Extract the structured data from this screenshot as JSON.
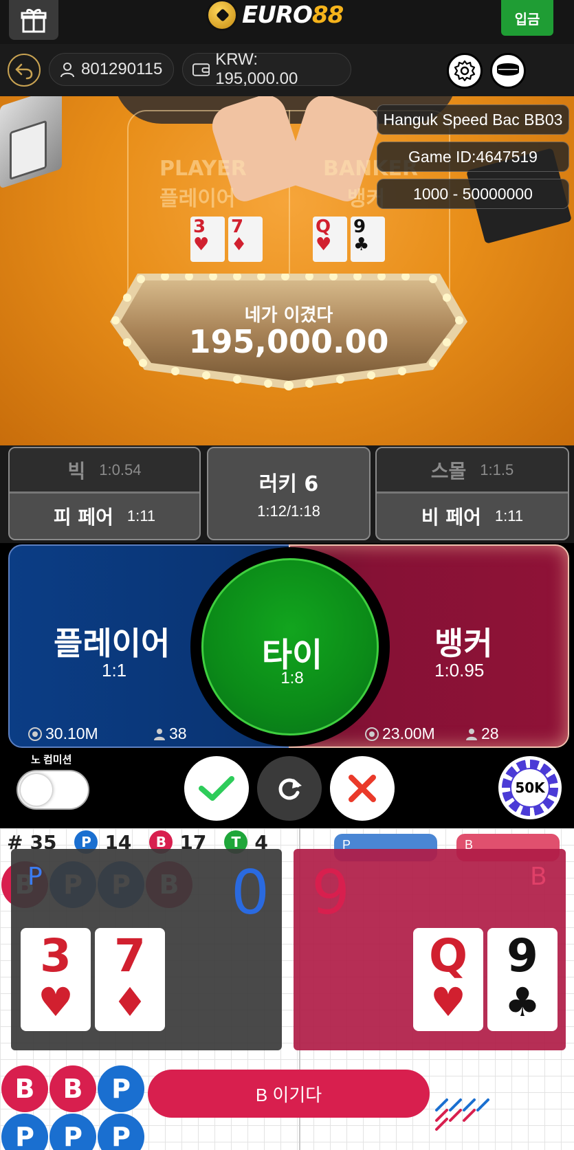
{
  "header": {
    "brand_left": "EURO",
    "brand_right": "88",
    "deposit_label": "입금"
  },
  "account": {
    "user_id": "801290115",
    "balance": "KRW: 195,000.00"
  },
  "video": {
    "table_words": [
      "PLAYER",
      "BANKER",
      "플레이어",
      "뱅커"
    ],
    "table_name": "Hanguk Speed Bac BB03",
    "game_id": "Game ID:4647519",
    "bet_limits": "1000 - 50000000",
    "player_cards": [
      {
        "rank": "3",
        "suit": "♥",
        "color": "red"
      },
      {
        "rank": "7",
        "suit": "♦",
        "color": "red"
      }
    ],
    "banker_cards": [
      {
        "rank": "Q",
        "suit": "♥",
        "color": "red"
      },
      {
        "rank": "9",
        "suit": "♣",
        "color": "black"
      }
    ],
    "win_label": "네가 이겼다",
    "win_amount": "195,000.00"
  },
  "side_bets": {
    "big": {
      "name": "빅",
      "odds": "1:0.54"
    },
    "player_pair": {
      "name": "피 페어",
      "odds": "1:11"
    },
    "lucky6": {
      "name": "러키 6",
      "odds": "1:12/1:18"
    },
    "small": {
      "name": "스몰",
      "odds": "1:1.5"
    },
    "banker_pair": {
      "name": "비 페어",
      "odds": "1:11"
    }
  },
  "main_bets": {
    "player": {
      "name": "플레이어",
      "odds": "1:1",
      "total": "30.10M",
      "players": "38"
    },
    "tie": {
      "name": "타이",
      "odds": "1:8"
    },
    "banker": {
      "name": "뱅커",
      "odds": "1:0.95",
      "total": "23.00M",
      "players": "28"
    }
  },
  "controls": {
    "no_commission_label": "노 컴미션",
    "chip_value": "50K"
  },
  "roadmap": {
    "total_label": "#",
    "total": "35",
    "player_badge": "P",
    "player_count": "14",
    "banker_badge": "B",
    "banker_count": "17",
    "tie_badge": "T",
    "tie_count": "4",
    "pred_player": "P",
    "pred_banker": "B",
    "beads_visible": [
      {
        "r": "B"
      },
      {
        "r": "P"
      },
      {
        "r": "P"
      },
      {
        "r": "B"
      },
      {
        "r": "B"
      },
      {
        "r": "B"
      },
      {
        "r": "P"
      },
      {
        "r": "P"
      },
      {
        "r": "P"
      },
      {
        "r": "P"
      }
    ]
  },
  "overlay": {
    "player_tag": "P",
    "player_score": "0",
    "banker_tag": "B",
    "banker_score": "9",
    "player_cards": [
      {
        "rank": "3",
        "suit": "♥",
        "color": "red"
      },
      {
        "rank": "7",
        "suit": "♦",
        "color": "red"
      }
    ],
    "banker_cards": [
      {
        "rank": "Q",
        "suit": "♥",
        "color": "red"
      },
      {
        "rank": "9",
        "suit": "♣",
        "color": "black"
      }
    ],
    "result": "B 이기다"
  },
  "colors": {
    "player_blue": "#1a6fd0",
    "banker_red": "#d81f4e",
    "tie_green": "#1fa63a",
    "brand_gold": "#f5b31b",
    "deposit_green": "#1f9d34"
  }
}
